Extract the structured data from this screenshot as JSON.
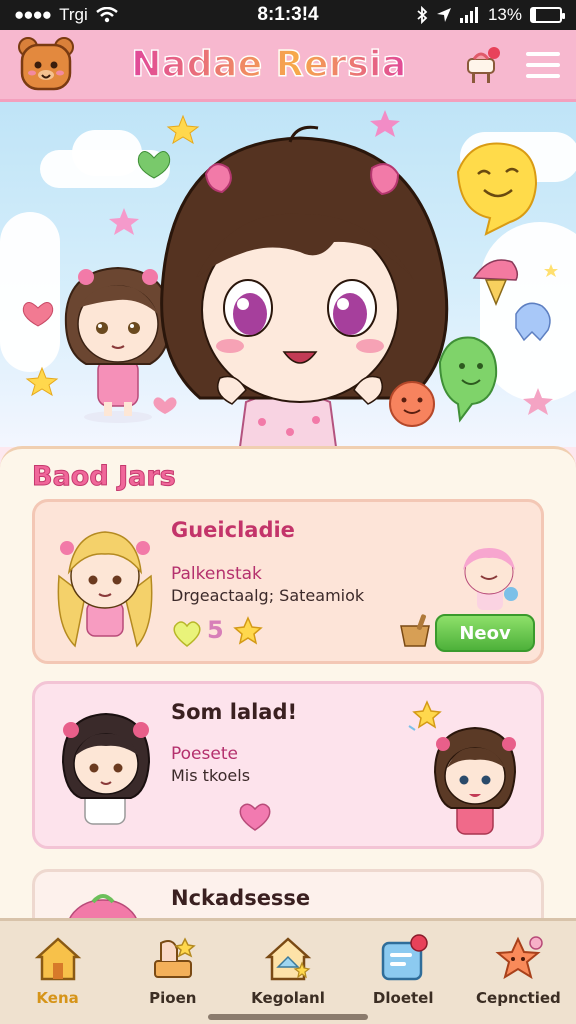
{
  "status_bar": {
    "carrier": "Trgi",
    "time": "8:1:3!4",
    "battery": "13%",
    "battery_level": 0.13
  },
  "header": {
    "title": "Nadae Rersia",
    "logo_icon": "bear-icon",
    "shop_icon": "cart-icon",
    "menu_icon": "hamburger-icon"
  },
  "section": {
    "title": "Baod Jars",
    "cards": [
      {
        "title": "Gueicladie",
        "subtitle": "Palkenstak",
        "meta": "Drgeactaalg; Sateamiok",
        "rating": "5",
        "button": "Neov"
      },
      {
        "title": "Som lalad!",
        "subtitle": "Poesete",
        "meta": "Mis tkoels"
      },
      {
        "title": "Nckadsesse"
      }
    ]
  },
  "nav": [
    {
      "label": "Kena",
      "icon": "home-icon",
      "active": true
    },
    {
      "label": "Pioen",
      "icon": "party-icon",
      "active": false
    },
    {
      "label": "Kegolanl",
      "icon": "house-sparkle-icon",
      "active": false
    },
    {
      "label": "Dloetel",
      "icon": "notes-icon",
      "active": false
    },
    {
      "label": "Cepnctied",
      "icon": "star-badge-icon",
      "active": false
    }
  ],
  "colors": {
    "header_bg": "#f7b8cf",
    "accent_pink": "#e0489a",
    "button_green": "#4db13a",
    "panel_bg": "#fdf6ea"
  }
}
